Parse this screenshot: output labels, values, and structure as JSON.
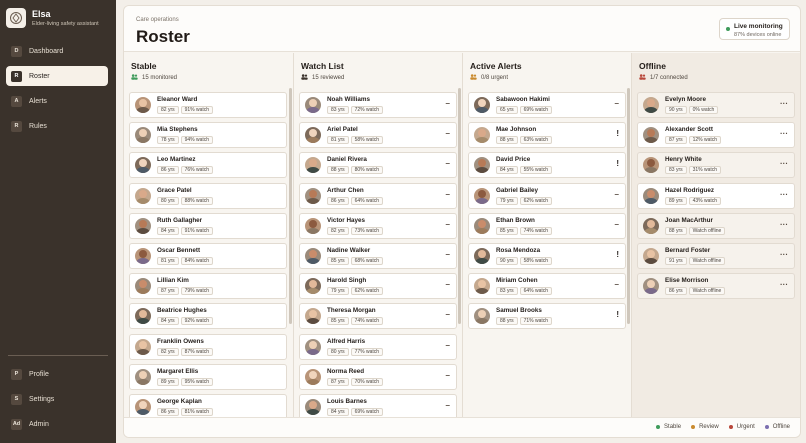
{
  "app": {
    "name": "Elsa",
    "subtitle": "Elder-living safety assistant"
  },
  "nav": [
    {
      "key": "D",
      "label": "Dashboard",
      "active": false
    },
    {
      "key": "R",
      "label": "Roster",
      "active": true
    },
    {
      "key": "A",
      "label": "Alerts",
      "active": false
    },
    {
      "key": "R",
      "label": "Rules",
      "active": false
    }
  ],
  "nav_bottom": [
    {
      "key": "P",
      "label": "Profile"
    },
    {
      "key": "S",
      "label": "Settings"
    },
    {
      "key": "Ad",
      "label": "Admin"
    }
  ],
  "header": {
    "eyebrow": "Care operations",
    "title": "Roster"
  },
  "monitoring": {
    "title": "Live monitoring",
    "status": "87% devices online"
  },
  "columns": [
    {
      "title": "Stable",
      "summary": "15 monitored",
      "icon": "people-icon",
      "residents": [
        {
          "name": "Eleanor Ward",
          "age": "82 yrs",
          "watch": "91% watch"
        },
        {
          "name": "Mia Stephens",
          "age": "78 yrs",
          "watch": "94% watch"
        },
        {
          "name": "Leo Martinez",
          "age": "86 yrs",
          "watch": "76% watch"
        },
        {
          "name": "Grace Patel",
          "age": "80 yrs",
          "watch": "88% watch"
        },
        {
          "name": "Ruth Gallagher",
          "age": "84 yrs",
          "watch": "91% watch"
        },
        {
          "name": "Oscar Bennett",
          "age": "81 yrs",
          "watch": "84% watch"
        },
        {
          "name": "Lillian Kim",
          "age": "87 yrs",
          "watch": "79% watch"
        },
        {
          "name": "Beatrice Hughes",
          "age": "84 yrs",
          "watch": "92% watch"
        },
        {
          "name": "Franklin Owens",
          "age": "82 yrs",
          "watch": "87% watch"
        },
        {
          "name": "Margaret Ellis",
          "age": "89 yrs",
          "watch": "95% watch"
        },
        {
          "name": "George Kaplan",
          "age": "86 yrs",
          "watch": "81% watch"
        }
      ]
    },
    {
      "title": "Watch List",
      "summary": "15 reviewed",
      "icon": "people-icon",
      "residents": [
        {
          "name": "Noah Williams",
          "age": "83 yrs",
          "watch": "72% watch",
          "action": "–"
        },
        {
          "name": "Ariel Patel",
          "age": "81 yrs",
          "watch": "58% watch",
          "action": "–"
        },
        {
          "name": "Daniel Rivera",
          "age": "88 yrs",
          "watch": "80% watch",
          "action": "–"
        },
        {
          "name": "Arthur Chen",
          "age": "86 yrs",
          "watch": "64% watch",
          "action": "–"
        },
        {
          "name": "Victor Hayes",
          "age": "82 yrs",
          "watch": "73% watch",
          "action": "–"
        },
        {
          "name": "Nadine Walker",
          "age": "85 yrs",
          "watch": "68% watch",
          "action": "–"
        },
        {
          "name": "Harold Singh",
          "age": "79 yrs",
          "watch": "62% watch",
          "action": "–"
        },
        {
          "name": "Theresa Morgan",
          "age": "85 yrs",
          "watch": "74% watch",
          "action": "–"
        },
        {
          "name": "Alfred Harris",
          "age": "80 yrs",
          "watch": "77% watch",
          "action": "–"
        },
        {
          "name": "Norma Reed",
          "age": "87 yrs",
          "watch": "70% watch",
          "action": "–"
        },
        {
          "name": "Louis Barnes",
          "age": "84 yrs",
          "watch": "69% watch",
          "action": "–"
        }
      ]
    },
    {
      "title": "Active Alerts",
      "summary": "0/8 urgent",
      "icon": "people-icon",
      "residents": [
        {
          "name": "Sabawoon Hakimi",
          "age": "65 yrs",
          "watch": "69% watch",
          "action": "–"
        },
        {
          "name": "Mae Johnson",
          "age": "88 yrs",
          "watch": "63% watch",
          "action": "!"
        },
        {
          "name": "David Price",
          "age": "84 yrs",
          "watch": "55% watch",
          "action": "!"
        },
        {
          "name": "Gabriel Bailey",
          "age": "79 yrs",
          "watch": "62% watch",
          "action": "–"
        },
        {
          "name": "Ethan Brown",
          "age": "85 yrs",
          "watch": "74% watch",
          "action": "–"
        },
        {
          "name": "Rosa Mendoza",
          "age": "90 yrs",
          "watch": "58% watch",
          "action": "!"
        },
        {
          "name": "Miriam Cohen",
          "age": "83 yrs",
          "watch": "64% watch",
          "action": "–"
        },
        {
          "name": "Samuel Brooks",
          "age": "88 yrs",
          "watch": "71% watch",
          "action": "!"
        }
      ]
    },
    {
      "title": "Offline",
      "summary": "1/7 connected",
      "icon": "people-icon",
      "residents": [
        {
          "name": "Evelyn Moore",
          "age": "90 yrs",
          "watch": "0% watch",
          "action": "···"
        },
        {
          "name": "Alexander Scott",
          "age": "87 yrs",
          "watch": "12% watch",
          "action": "···"
        },
        {
          "name": "Henry White",
          "age": "83 yrs",
          "watch": "31% watch",
          "action": "···"
        },
        {
          "name": "Hazel Rodriguez",
          "age": "89 yrs",
          "watch": "43% watch",
          "action": "···"
        },
        {
          "name": "Joan MacArthur",
          "age": "88 yrs",
          "watch": "Watch offline",
          "action": "···"
        },
        {
          "name": "Bernard Foster",
          "age": "91 yrs",
          "watch": "Watch offline",
          "action": "···"
        },
        {
          "name": "Elise Morrison",
          "age": "86 yrs",
          "watch": "Watch offline",
          "action": "···"
        }
      ]
    }
  ],
  "legend": [
    {
      "label": "Stable",
      "color": "#3f9b5b"
    },
    {
      "label": "Review",
      "color": "#c98a2e"
    },
    {
      "label": "Urgent",
      "color": "#b8473a"
    },
    {
      "label": "Offline",
      "color": "#7c6fb0"
    }
  ],
  "colors": {
    "sidebar": "#3a322b",
    "stable": "#3f9b5b",
    "review": "#c98a2e",
    "urgent": "#b8473a",
    "offline": "#7c6fb0"
  }
}
